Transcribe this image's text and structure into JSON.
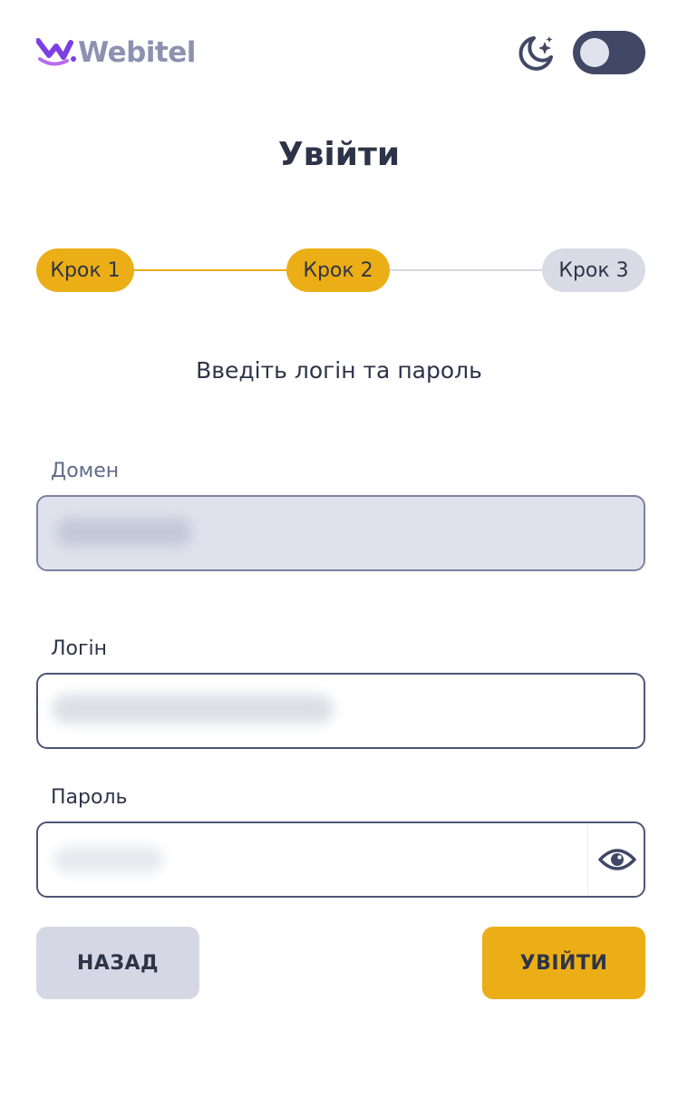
{
  "header": {
    "logo_text": "Webitel",
    "theme_icon": "moon-stars-icon",
    "theme_toggle_on": false
  },
  "title": "Увійти",
  "stepper": {
    "steps": [
      {
        "label": "Крок 1",
        "state": "active"
      },
      {
        "label": "Крок 2",
        "state": "active"
      },
      {
        "label": "Крок 3",
        "state": "inactive"
      }
    ]
  },
  "subtitle": "Введіть логін та пароль",
  "form": {
    "domain": {
      "label": "Домен",
      "value": "",
      "disabled": true
    },
    "login": {
      "label": "Логін",
      "value": ""
    },
    "password": {
      "label": "Пароль",
      "value": "",
      "toggle_icon": "eye-icon"
    }
  },
  "buttons": {
    "back": "НАЗАД",
    "login": "УВІЙТИ"
  },
  "colors": {
    "accent": "#ecae16",
    "text": "#2e3448",
    "logo": "#8d91b0",
    "logo_mark": "#7b3fe4",
    "toggle_bg": "#404866",
    "inactive_step": "#d8dbe6"
  }
}
